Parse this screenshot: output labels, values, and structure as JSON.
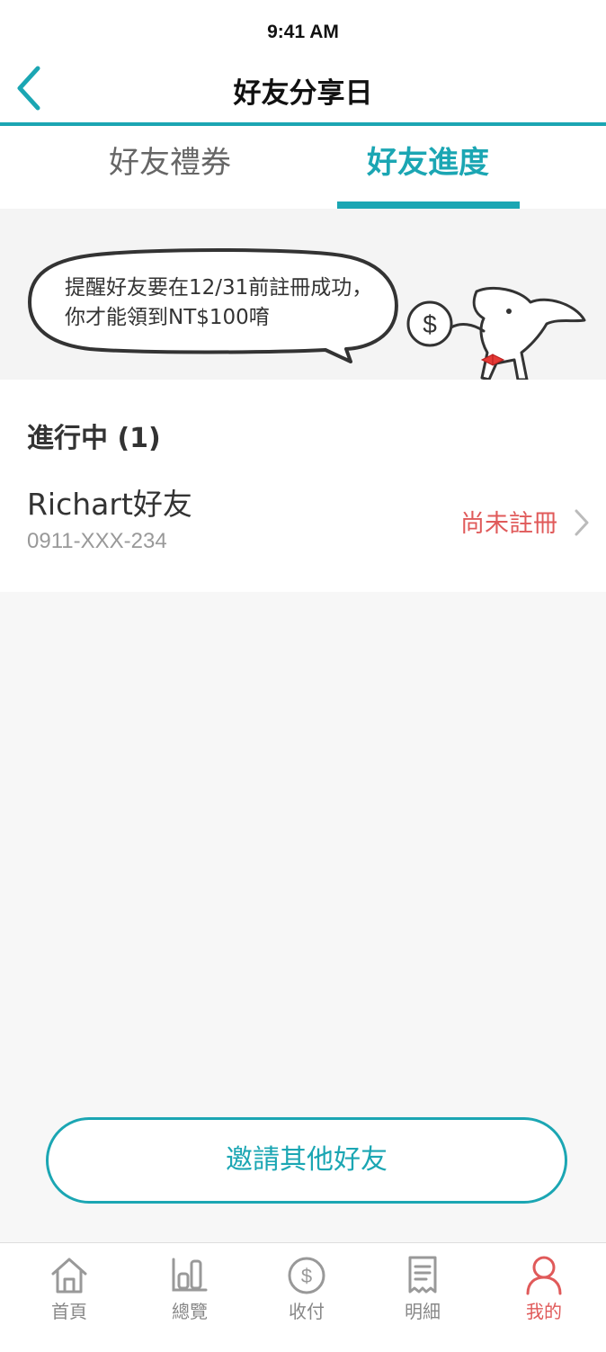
{
  "status_bar": {
    "time": "9:41 AM"
  },
  "nav": {
    "title": "好友分享日",
    "back_icon": "chevron-left-icon"
  },
  "tabs": [
    {
      "label": "好友禮券",
      "active": false
    },
    {
      "label": "好友進度",
      "active": true
    }
  ],
  "banner": {
    "message": "提醒好友要在12/31前註冊成功，你才能領到NT$100唷"
  },
  "section": {
    "heading": "進行中 (1)",
    "friends": [
      {
        "name": "Richart好友",
        "phone": "0911-XXX-234",
        "status": "尚未註冊"
      }
    ]
  },
  "invite_button": {
    "label": "邀請其他好友"
  },
  "tabbar": [
    {
      "label": "首頁",
      "icon": "home-icon",
      "active": false
    },
    {
      "label": "總覽",
      "icon": "overview-icon",
      "active": false
    },
    {
      "label": "收付",
      "icon": "payment-icon",
      "active": false
    },
    {
      "label": "明細",
      "icon": "statement-icon",
      "active": false
    },
    {
      "label": "我的",
      "icon": "profile-icon",
      "active": true
    }
  ],
  "colors": {
    "accent": "#1ba6b3",
    "alert": "#e05a5a",
    "background": "#f7f7f7"
  }
}
